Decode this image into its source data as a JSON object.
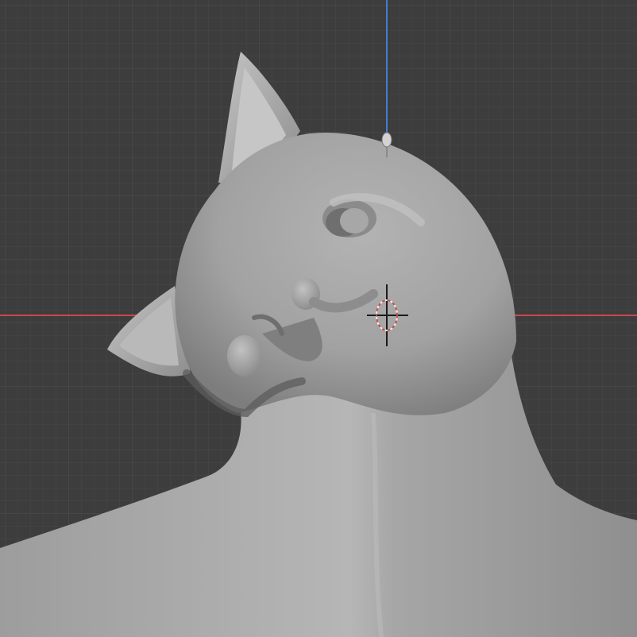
{
  "app": "3D viewport",
  "viewport": {
    "background_color": "#3d3d3d",
    "grid_minor_color": "#474747",
    "grid_major_color": "#4f4f4f",
    "x_axis_color": "#c9474e",
    "z_axis_color": "#3f7fd6",
    "mesh_base_color": "#a8a8a8"
  },
  "objects": {
    "mesh": "sculpted-cat-mesh",
    "cursor": "3d-cursor-icon",
    "light": "light-gizmo-icon"
  }
}
